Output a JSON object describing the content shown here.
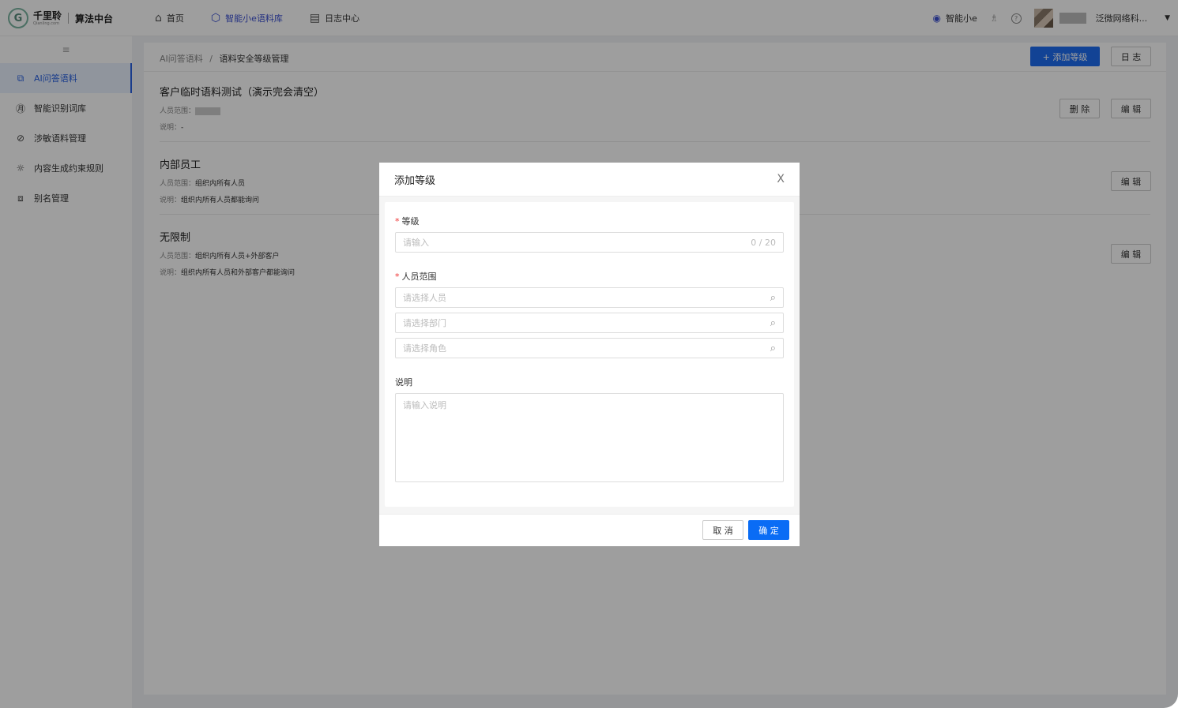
{
  "header": {
    "logo_cn": "千里聆",
    "logo_en": "Qianling.com",
    "app_title": "算法中台",
    "nav": [
      {
        "label": "首页",
        "icon": "home-icon"
      },
      {
        "label": "智能小e语料库",
        "icon": "cube-icon"
      },
      {
        "label": "日志中心",
        "icon": "log-icon"
      }
    ],
    "assistant_label": "智能小e",
    "org_name": "泛微网络科..."
  },
  "sidebar": {
    "collapse_glyph": "≡",
    "items": [
      {
        "label": "AI问答语料",
        "icon": "qa-icon"
      },
      {
        "label": "智能识别词库",
        "icon": "word-icon"
      },
      {
        "label": "涉敏语料管理",
        "icon": "ban-icon"
      },
      {
        "label": "内容生成约束规则",
        "icon": "bug-icon"
      },
      {
        "label": "别名管理",
        "icon": "alias-icon"
      }
    ]
  },
  "main": {
    "breadcrumb_root": "AI问答语料",
    "breadcrumb_sep": "/",
    "breadcrumb_current": "语料安全等级管理",
    "add_level_button": "+ 添加等级",
    "log_button": "日 志",
    "delete_button": "删 除",
    "edit_button": "编 辑",
    "scope_prefix": "人员范围：",
    "desc_prefix": "说明：",
    "levels": [
      {
        "name": "客户临时语料测试（演示完会清空）",
        "scope": "",
        "desc": "-"
      },
      {
        "name": "内部员工",
        "scope": "组织内所有人员",
        "desc": "组织内所有人员都能询问"
      },
      {
        "name": "无限制",
        "scope": "组织内所有人员+外部客户",
        "desc": "组织内所有人员和外部客户都能询问"
      }
    ]
  },
  "modal": {
    "title": "添加等级",
    "close": "X",
    "level_label": "等级",
    "level_placeholder": "请输入",
    "level_counter": "0 / 20",
    "scope_label": "人员范围",
    "scope_person_placeholder": "请选择人员",
    "scope_dept_placeholder": "请选择部门",
    "scope_role_placeholder": "请选择角色",
    "desc_label": "说明",
    "desc_placeholder": "请输入说明",
    "cancel": "取 消",
    "confirm": "确 定",
    "required_mark": "*"
  },
  "colors": {
    "primary": "#1d6cf0",
    "nav_active": "#3b4fd1",
    "required": "#e33333"
  }
}
